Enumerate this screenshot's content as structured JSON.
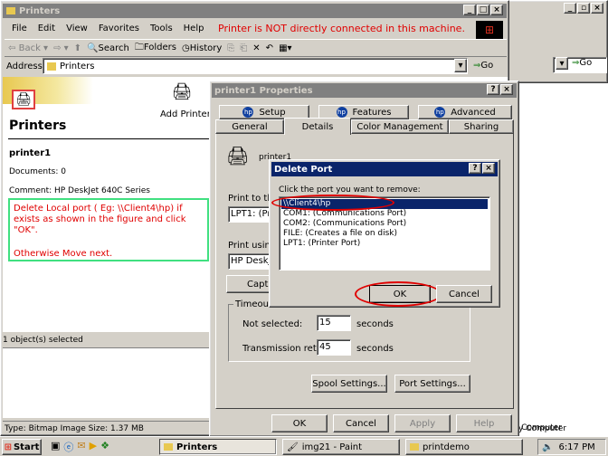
{
  "explorer": {
    "title": "Printers",
    "warning": "Printer is NOT directly connected in this machine.",
    "menu": [
      "File",
      "Edit",
      "View",
      "Favorites",
      "Tools",
      "Help"
    ],
    "toolbar": {
      "back": "Back",
      "search": "Search",
      "folders": "Folders",
      "history": "History"
    },
    "address_label": "Address",
    "address_value": "Printers",
    "go": "Go",
    "add_printer": "Add Printer",
    "panel_title": "Printers",
    "printer_name": "printer1",
    "documents": "Documents: 0",
    "comment": "Comment: HP DeskJet 640C Series",
    "instruction": "Delete Local port ( Eg: \\\\Client4\\hp) if exists as shown in the figure and click \"OK\".",
    "otherwise": "Otherwise Move next.",
    "status_objects": "1 object(s) selected",
    "status_type": "Type: Bitmap Image Size: 1.37 MB",
    "status_right": "y Computer"
  },
  "bg_window": {
    "go": "Go"
  },
  "props": {
    "title": "printer1 Properties",
    "tabs_top": [
      "Setup",
      "Features",
      "Advanced"
    ],
    "tabs_bottom": [
      "General",
      "Details",
      "Color Management",
      "Sharing"
    ],
    "printer_name": "printer1",
    "print_to": "Print to the",
    "print_to_value": "LPT1:  (Pri",
    "print_using": "Print using t",
    "print_using_value": "HP DeskJ",
    "capture": "Captu",
    "timeout": "Timeout s",
    "not_selected": "Not selected:",
    "not_selected_value": "15",
    "transmission": "Transmission retry:",
    "transmission_value": "45",
    "seconds": "seconds",
    "spool": "Spool Settings...",
    "port": "Port Settings...",
    "ok": "OK",
    "cancel": "Cancel",
    "apply": "Apply",
    "help": "Help"
  },
  "delete_port": {
    "title": "Delete Port",
    "prompt": "Click the port you want to remove:",
    "ports": [
      "\\\\Client4\\hp",
      "COM1:  (Communications Port)",
      "COM2:  (Communications Port)",
      "FILE:  (Creates a file on disk)",
      "LPT1:  (Printer Port)"
    ],
    "ok": "OK",
    "cancel": "Cancel"
  },
  "taskbar": {
    "start": "Start",
    "tasks": [
      "Printers",
      "img21 - Paint",
      "printdemo"
    ],
    "clock": "6:17 PM"
  },
  "colors": {
    "title_active": "#0a246a",
    "face": "#d4d0c8",
    "highlight_red": "#e00000",
    "annotation_green": "#40e080"
  }
}
